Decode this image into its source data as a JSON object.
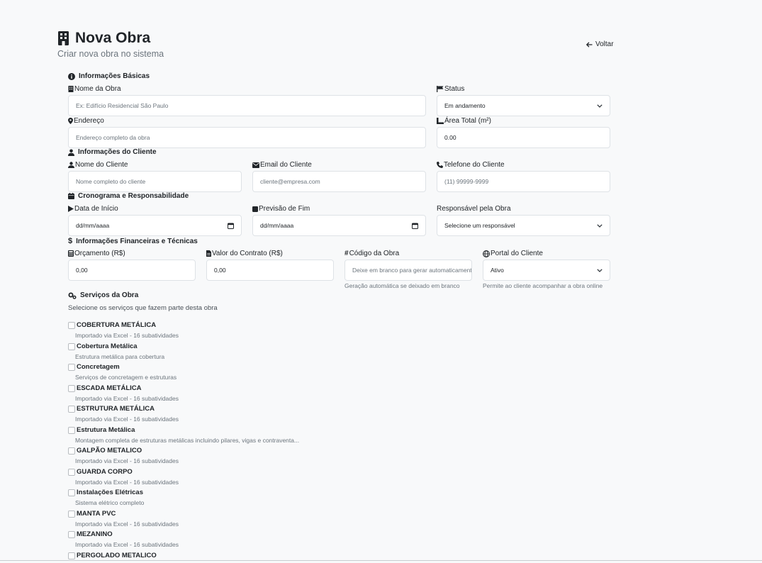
{
  "header": {
    "title": "Nova Obra",
    "subtitle": "Criar nova obra no sistema",
    "back_label": "Voltar"
  },
  "basic": {
    "section_title": "Informações Básicas",
    "name_label": "Nome da Obra",
    "name_placeholder": "Ex: Edifício Residencial São Paulo",
    "status_label": "Status",
    "status_value": "Em andamento",
    "address_label": "Endereço",
    "address_placeholder": "Endereço completo da obra",
    "area_label": "Área Total (m²)",
    "area_value": "0.00"
  },
  "client": {
    "section_title": "Informações do Cliente",
    "name_label": "Nome do Cliente",
    "name_placeholder": "Nome completo do cliente",
    "email_label": "Email do Cliente",
    "email_placeholder": "cliente@empresa.com",
    "phone_label": "Telefone do Cliente",
    "phone_placeholder": "(11) 99999-9999"
  },
  "schedule": {
    "section_title": "Cronograma e Responsabilidade",
    "start_label": "Data de Início",
    "start_value": "dd/mm/aaaa",
    "end_label": "Previsão de Fim",
    "end_value": "dd/mm/aaaa",
    "responsible_label": "Responsável pela Obra",
    "responsible_value": "Selecione um responsável"
  },
  "financial": {
    "section_title": "Informações Financeiras e Técnicas",
    "budget_label": "Orçamento (R$)",
    "budget_value": "0,00",
    "contract_label": "Valor do Contrato (R$)",
    "contract_value": "0,00",
    "code_label": "Código da Obra",
    "code_placeholder": "Deixe em branco para gerar automaticamente",
    "code_help": "Geração automática se deixado em branco",
    "portal_label": "Portal do Cliente",
    "portal_value": "Ativo",
    "portal_help": "Permite ao cliente acompanhar a obra online"
  },
  "services": {
    "section_title": "Serviços da Obra",
    "subtitle": "Selecione os serviços que fazem parte desta obra",
    "items": [
      {
        "name": "COBERTURA METÁLICA",
        "desc": "Importado via Excel - 16 subatividades"
      },
      {
        "name": "Cobertura Metálica",
        "desc": "Estrutura metálica para cobertura"
      },
      {
        "name": "Concretagem",
        "desc": "Serviços de concretagem e estruturas"
      },
      {
        "name": "ESCADA METÁLICA",
        "desc": "Importado via Excel - 16 subatividades"
      },
      {
        "name": "ESTRUTURA METÁLICA",
        "desc": "Importado via Excel - 16 subatividades"
      },
      {
        "name": "Estrutura Metálica",
        "desc": "Montagem completa de estruturas metálicas incluindo pilares, vigas e contraventa..."
      },
      {
        "name": "GALPÃO METALICO",
        "desc": "Importado via Excel - 16 subatividades"
      },
      {
        "name": "GUARDA CORPO",
        "desc": "Importado via Excel - 16 subatividades"
      },
      {
        "name": "Instalações Elétricas",
        "desc": "Sistema elétrico completo"
      },
      {
        "name": "MANTA PVC",
        "desc": "Importado via Excel - 16 subatividades"
      },
      {
        "name": "MEZANINO",
        "desc": "Importado via Excel - 16 subatividades"
      },
      {
        "name": "PERGOLADO METALICO",
        "desc": ""
      }
    ]
  }
}
